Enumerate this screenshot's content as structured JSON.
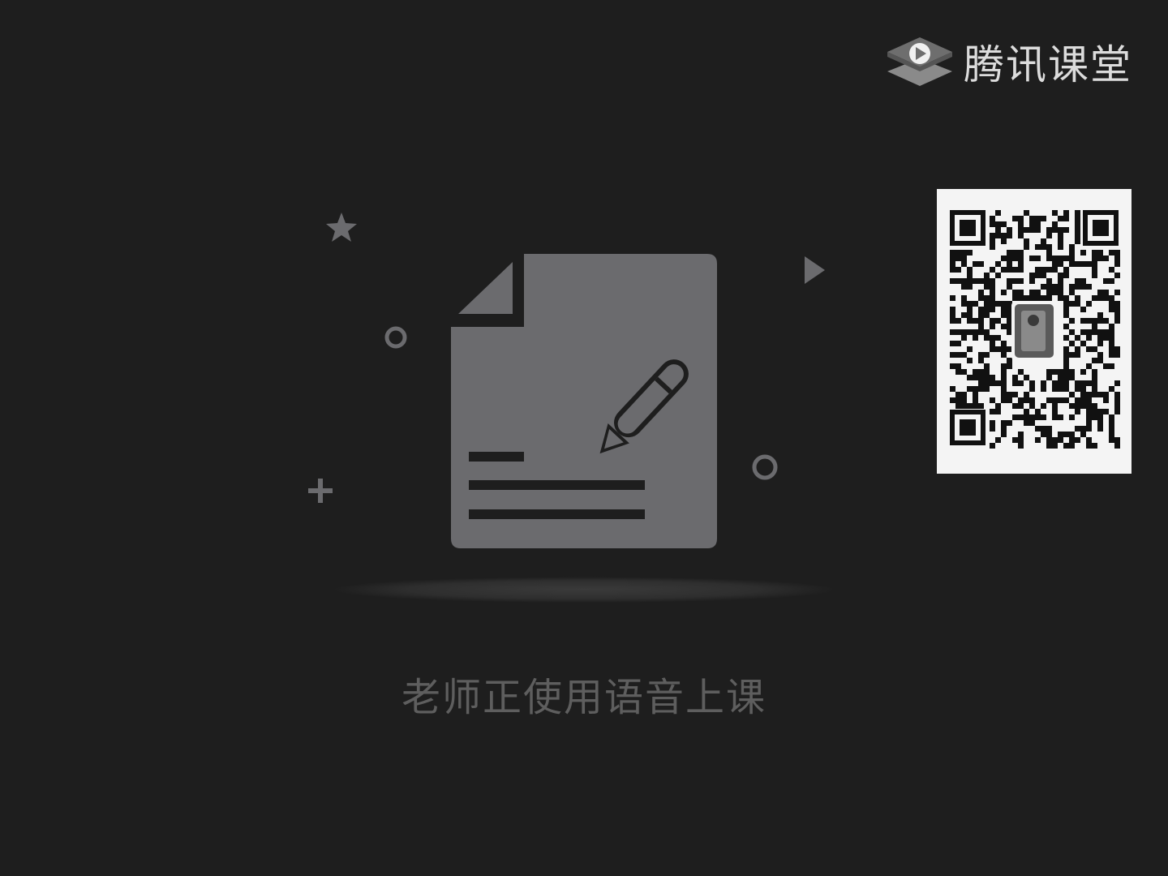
{
  "brand": {
    "name": "腾讯课堂",
    "icon": "tencent-classroom-logo-icon"
  },
  "qr_code": {
    "icon": "qr-code"
  },
  "status": {
    "message": "老师正使用语音上课"
  },
  "illustration": {
    "icons": [
      "document-icon",
      "pencil-icon",
      "star-icon",
      "play-triangle-icon",
      "circle-icon",
      "plus-icon"
    ]
  },
  "colors": {
    "background": "#1e1e1e",
    "illustration_gray": "#6b6b6e",
    "caption_gray": "#5e5e5e",
    "brand_text": "#dcdcdc"
  }
}
